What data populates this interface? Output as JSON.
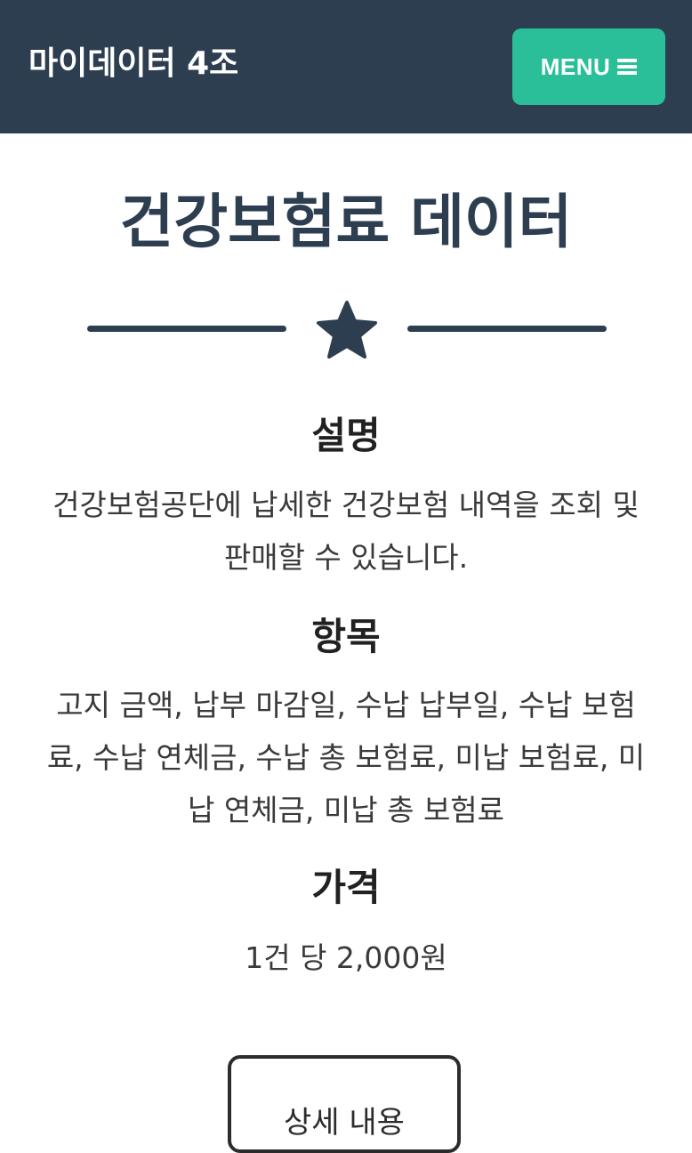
{
  "navbar": {
    "brand": "마이데이터 4조",
    "menu_label": "MENU",
    "menu_icon": "hamburger-icon",
    "background_color": "#2c3e50",
    "menu_color": "#2bbf99"
  },
  "main": {
    "title": "건강보험료 데이터",
    "divider_icon": "star-icon",
    "sections": [
      {
        "heading": "설명",
        "text": "건강보험공단에 납세한 건강보험 내역을 조회 및 판매할 수 있습니다."
      },
      {
        "heading": "항목",
        "text": "고지 금액, 납부 마감일, 수납 납부일, 수납 보험료, 수납 연체금, 수납 총 보험료, 미납 보험료, 미납 연체금, 미납 총 보험료"
      },
      {
        "heading": "가격",
        "text": "1건 당 2,000원"
      }
    ],
    "detail_button_label": "상세 내용"
  }
}
